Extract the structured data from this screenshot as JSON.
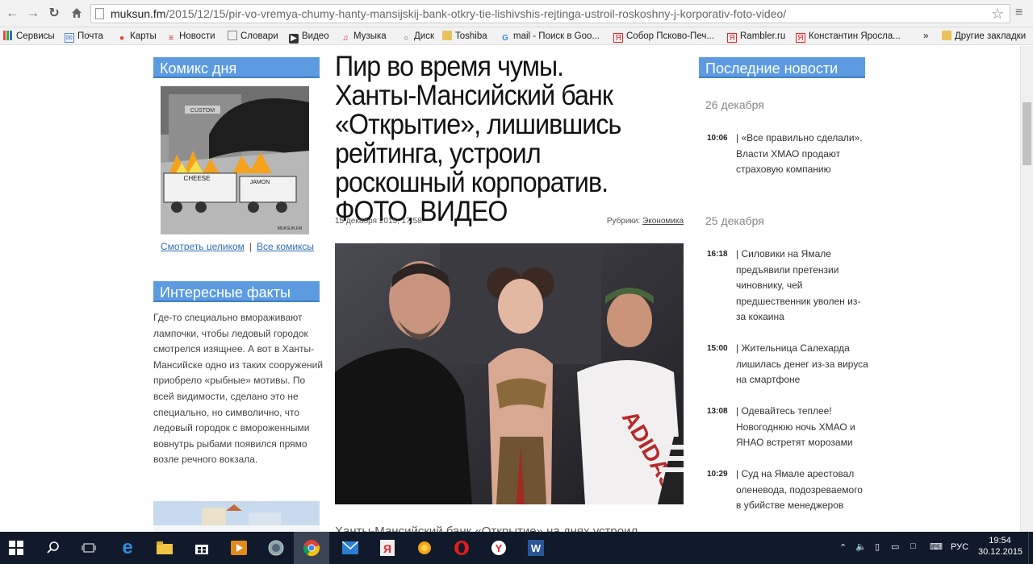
{
  "browser": {
    "url_domain": "muksun.fm",
    "url_path": "/2015/12/15/pir-vo-vremya-chumy-hanty-mansijskij-bank-otkry-tie-lishivshis-rejtinga-ustroil-roskoshny-j-korporativ-foto-video/",
    "bookmarks": [
      "Сервисы",
      "Почта",
      "Карты",
      "Новости",
      "Словари",
      "Видео",
      "Музыка",
      "Диск",
      "Toshiba",
      "mail - Поиск в Goo...",
      "Собор Псково-Печ...",
      "Rambler.ru",
      "Константин Яросла..."
    ],
    "other_bookmarks": "Другие закладки",
    "overflow": "»"
  },
  "left": {
    "comic_title": "Комикс дня",
    "comic_labels": {
      "custom": "CUSTOM",
      "cheese": "CHEESE",
      "jamon": "JAMON",
      "signature": "MUKSUN.FM"
    },
    "comic_link_full": "Смотреть целиком",
    "comic_link_sep": "|",
    "comic_link_all": "Все комиксы",
    "facts_title": "Интересные факты",
    "facts_text": "Где-то специально вмораживают лампочки, чтобы ледовый городок смотрелся изящнее. А вот в Ханты-Мансийске одно из таких сооружений приобрело «рыбные» мотивы. По всей видимости, сделано это не специально, но символично, что ледовый городок с вмороженными вовнутрь рыбами появился прямо возле речного вокзала."
  },
  "article": {
    "title": "Пир во время чумы. Ханты-Мансийский банк «Открытие», лишившись рейтинга, устроил роскошный корпоратив. ФОТО, ВИДЕО",
    "date": "15 декабря 2015, 17:58",
    "rubric_label": "Рубрики:",
    "rubric": "Экономика",
    "photo_shirt_text": "ADIDAS",
    "lead": "Ханты-Мансийский банк «Открытие» на днях устроил"
  },
  "right": {
    "title": "Последние новости",
    "date1": "26 декабря",
    "date2": "25 декабря",
    "news": [
      {
        "time": "10:06",
        "sep": "|",
        "text": "«Все правильно сделали». Власти ХМАО продают страховую компанию"
      },
      {
        "time": "16:18",
        "sep": "|",
        "text": "Силовики на Ямале предъявили претензии чиновнику, чей предшественник уволен из-за кокаина"
      },
      {
        "time": "15:00",
        "sep": "|",
        "text": "Жительница Салехарда лишилась денег из-за вируса на смартфоне"
      },
      {
        "time": "13:08",
        "sep": "|",
        "text": "Одевайтесь теплее! Новогоднюю ночь ХМАО и ЯНАО встретят морозами"
      },
      {
        "time": "10:29",
        "sep": "|",
        "text": "Суд на Ямале арестовал оленевода, подозреваемого в убийстве менеджеров"
      }
    ]
  },
  "taskbar": {
    "lang": "РУС",
    "time": "19:54",
    "date": "30.12.2015"
  },
  "colors": {
    "widget_blue": "#5c9be0",
    "link_blue": "#2f6fb5",
    "taskbar": "#101a2a"
  }
}
